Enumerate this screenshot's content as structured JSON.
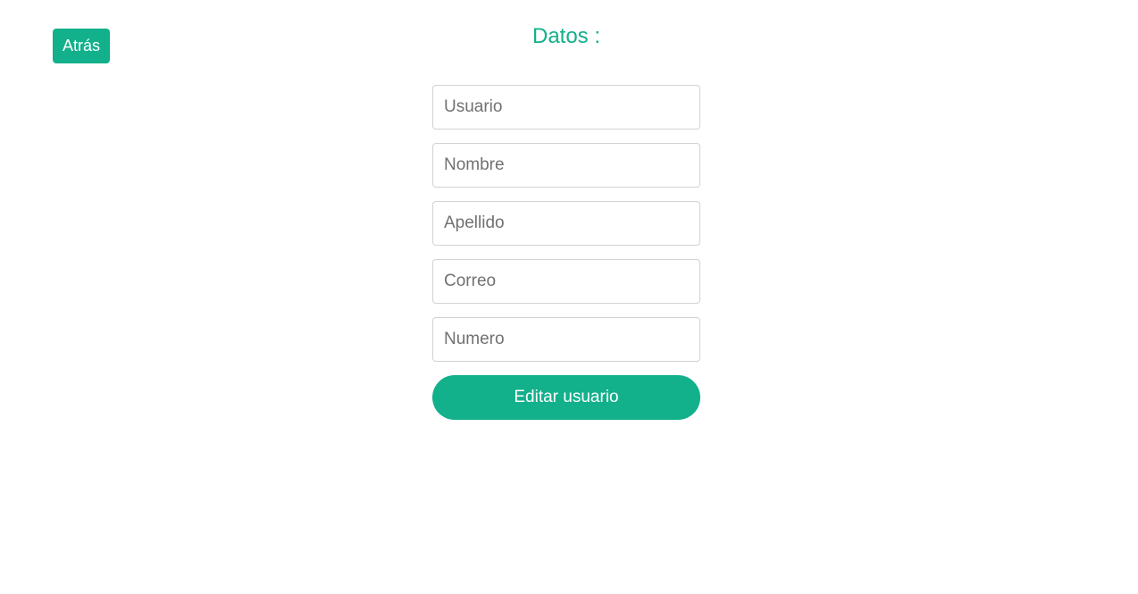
{
  "header": {
    "back_label": "Atrás",
    "title": "Datos :"
  },
  "form": {
    "fields": [
      {
        "placeholder": "Usuario",
        "value": ""
      },
      {
        "placeholder": "Nombre",
        "value": ""
      },
      {
        "placeholder": "Apellido",
        "value": ""
      },
      {
        "placeholder": "Correo",
        "value": ""
      },
      {
        "placeholder": "Numero",
        "value": ""
      }
    ],
    "submit_label": "Editar usuario"
  },
  "colors": {
    "accent": "#12b08b",
    "background": "#ffffff",
    "input_border": "#d2d2d2",
    "placeholder": "#717171"
  }
}
